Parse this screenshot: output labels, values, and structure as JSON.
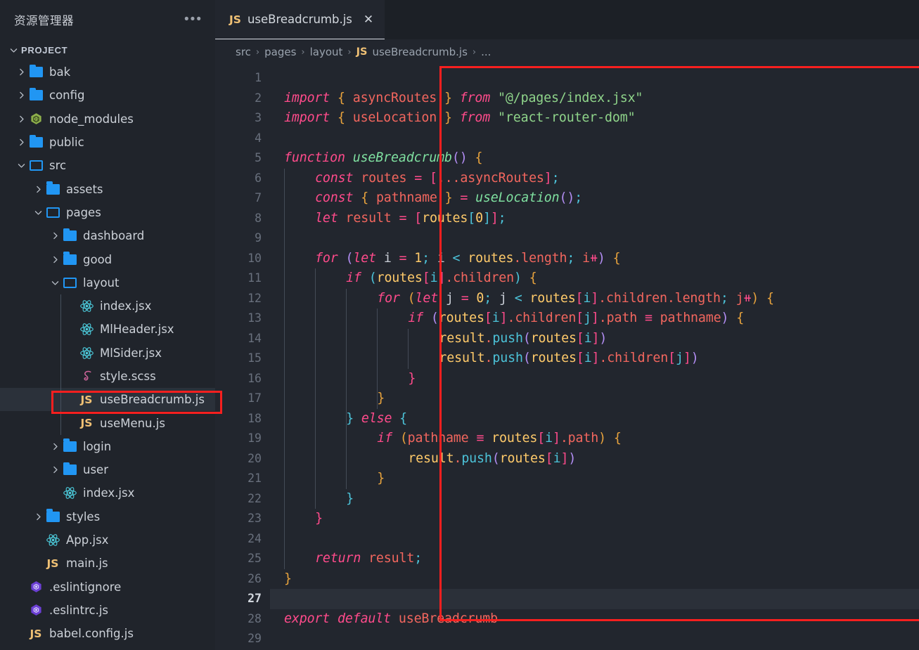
{
  "sidebar": {
    "title": "资源管理器",
    "more_icon": "ellipsis-icon",
    "section_label": "PROJECT",
    "items": [
      {
        "label": "bak",
        "type": "folder",
        "indent": 0,
        "state": "collapsed",
        "icon": "folder-icon"
      },
      {
        "label": "config",
        "type": "folder",
        "indent": 0,
        "state": "collapsed",
        "icon": "folder-icon"
      },
      {
        "label": "node_modules",
        "type": "node_modules",
        "indent": 0,
        "state": "collapsed",
        "icon": "node-modules-icon"
      },
      {
        "label": "public",
        "type": "folder",
        "indent": 0,
        "state": "collapsed",
        "icon": "folder-icon"
      },
      {
        "label": "src",
        "type": "folder",
        "indent": 0,
        "state": "expanded",
        "icon": "folder-open-icon"
      },
      {
        "label": "assets",
        "type": "folder",
        "indent": 1,
        "state": "collapsed",
        "icon": "folder-icon"
      },
      {
        "label": "pages",
        "type": "folder",
        "indent": 1,
        "state": "expanded",
        "icon": "folder-open-icon"
      },
      {
        "label": "dashboard",
        "type": "folder",
        "indent": 2,
        "state": "collapsed",
        "icon": "folder-icon"
      },
      {
        "label": "good",
        "type": "folder",
        "indent": 2,
        "state": "collapsed",
        "icon": "folder-icon"
      },
      {
        "label": "layout",
        "type": "folder",
        "indent": 2,
        "state": "expanded",
        "icon": "folder-open-icon"
      },
      {
        "label": "index.jsx",
        "type": "react",
        "indent": 3,
        "state": "file",
        "icon": "react-icon"
      },
      {
        "label": "MlHeader.jsx",
        "type": "react",
        "indent": 3,
        "state": "file",
        "icon": "react-icon"
      },
      {
        "label": "MlSider.jsx",
        "type": "react",
        "indent": 3,
        "state": "file",
        "icon": "react-icon"
      },
      {
        "label": "style.scss",
        "type": "scss",
        "indent": 3,
        "state": "file",
        "icon": "sass-icon"
      },
      {
        "label": "useBreadcrumb.js",
        "type": "js",
        "indent": 3,
        "state": "file",
        "icon": "js-icon",
        "selected": true,
        "highlighted": true
      },
      {
        "label": "useMenu.js",
        "type": "js",
        "indent": 3,
        "state": "file",
        "icon": "js-icon"
      },
      {
        "label": "login",
        "type": "folder",
        "indent": 2,
        "state": "collapsed",
        "icon": "folder-icon"
      },
      {
        "label": "user",
        "type": "folder",
        "indent": 2,
        "state": "collapsed",
        "icon": "folder-icon"
      },
      {
        "label": "index.jsx",
        "type": "react",
        "indent": 2,
        "state": "file",
        "icon": "react-icon"
      },
      {
        "label": "styles",
        "type": "folder",
        "indent": 1,
        "state": "collapsed",
        "icon": "folder-icon"
      },
      {
        "label": "App.jsx",
        "type": "react",
        "indent": 1,
        "state": "file",
        "icon": "react-icon"
      },
      {
        "label": "main.js",
        "type": "js",
        "indent": 1,
        "state": "file",
        "icon": "js-icon"
      },
      {
        "label": ".eslintignore",
        "type": "eslint",
        "indent": 0,
        "state": "file",
        "icon": "eslint-icon"
      },
      {
        "label": ".eslintrc.js",
        "type": "eslint",
        "indent": 0,
        "state": "file",
        "icon": "eslint-icon"
      },
      {
        "label": "babel.config.js",
        "type": "js",
        "indent": 0,
        "state": "file",
        "icon": "js-icon"
      }
    ]
  },
  "tab": {
    "badge": "JS",
    "label": "useBreadcrumb.js",
    "close_icon": "close-icon"
  },
  "breadcrumb": {
    "parts": [
      "src",
      "pages",
      "layout"
    ],
    "badge": "JS",
    "file": "useBreadcrumb.js",
    "overflow": "...",
    "separator": "›"
  },
  "editor": {
    "active_line": 27,
    "first_line": 1,
    "last_line": 29,
    "line_numbers": [
      1,
      2,
      3,
      4,
      5,
      6,
      7,
      8,
      9,
      10,
      11,
      12,
      13,
      14,
      15,
      16,
      17,
      18,
      19,
      20,
      21,
      22,
      23,
      24,
      25,
      26,
      27,
      28,
      29
    ],
    "lines": [
      "",
      "import { asyncRoutes } from \"@/pages/index.jsx\"",
      "import { useLocation } from \"react-router-dom\"",
      "",
      "function useBreadcrumb() {",
      "    const routes = [...asyncRoutes];",
      "    const { pathname } = useLocation();",
      "    let result = [routes[0]];",
      "",
      "    for (let i = 1; i < routes.length; i++) {",
      "        if (routes[i].children) {",
      "            for (let j = 0; j < routes[i].children.length; j++) {",
      "                if (routes[i].children[j].path === pathname) {",
      "                    result.push(routes[i])",
      "                    result.push(routes[i].children[j])",
      "                }",
      "            }",
      "        } else {",
      "            if (pathname === routes[i].path) {",
      "                result.push(routes[i])",
      "            }",
      "        }",
      "    }",
      "",
      "    return result;",
      "}",
      "",
      "export default useBreadcrumb",
      ""
    ]
  },
  "annotations": {
    "code_box_color": "#f81f1f",
    "sidebar_box_color": "#f81f1f"
  },
  "colors": {
    "sidebar_bg": "#20242b",
    "editor_bg": "#22262e",
    "tabbar_bg": "#1c2026",
    "selected_row": "#2b313a",
    "active_line": "#2b3039",
    "keyword": "#ff4b8b",
    "string": "#8fd48a",
    "function": "#7fe0a0",
    "variable": "#f2665e",
    "brace": "#e8a33d",
    "number": "#ffca6a",
    "cyan": "#4cc3d9",
    "purple": "#b48ef5"
  }
}
